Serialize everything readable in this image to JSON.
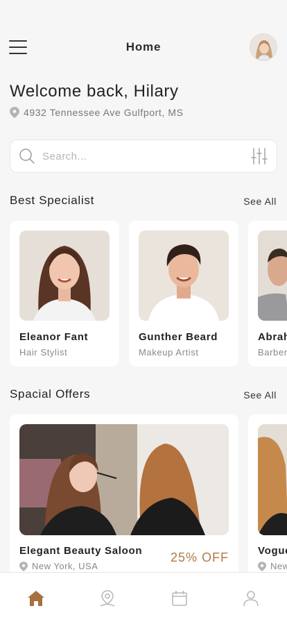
{
  "header": {
    "title": "Home",
    "menu_icon": "hamburger-menu-icon",
    "avatar": "user-avatar"
  },
  "welcome": {
    "greeting": "Welcome back, Hilary",
    "address": "4932 Tennessee Ave Gulfport, MS"
  },
  "search": {
    "placeholder": "Search...",
    "value": "",
    "filter_icon": "filter-sliders-icon"
  },
  "specialists": {
    "title": "Best Specialist",
    "see_all": "See All",
    "items": [
      {
        "name": "Eleanor Fant",
        "role": "Hair Stylist"
      },
      {
        "name": "Gunther Beard",
        "role": "Makeup Artist"
      },
      {
        "name": "Abrah",
        "role": "Barber"
      }
    ]
  },
  "offers": {
    "title": "Spacial Offers",
    "see_all": "See All",
    "items": [
      {
        "name": "Elegant Beauty Saloon",
        "location": "New York, USA",
        "discount": "25% OFF"
      },
      {
        "name": "Vogue",
        "location": "New",
        "discount": ""
      }
    ]
  },
  "tabbar": {
    "active_color": "#a6713f",
    "inactive_color": "#b9b9b9",
    "tabs": [
      "home-icon",
      "map-pin-icon",
      "calendar-icon",
      "profile-icon"
    ]
  }
}
